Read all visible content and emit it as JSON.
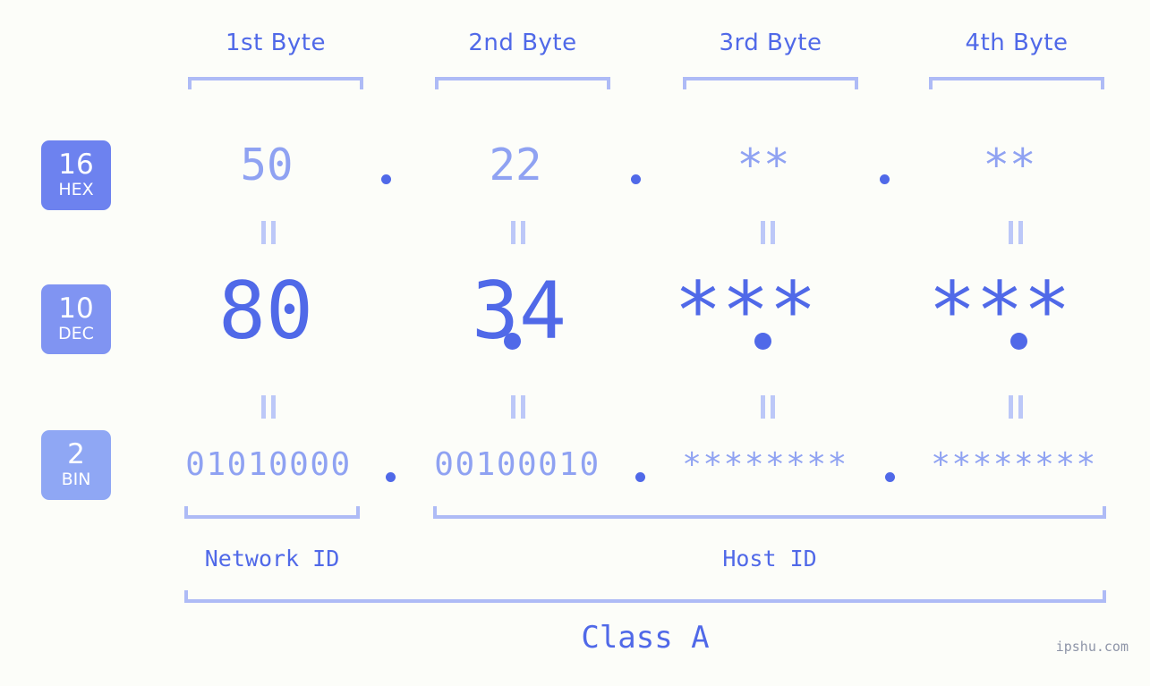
{
  "colors": {
    "background": "#fcfdf9",
    "accent_strong": "#5069e8",
    "accent_mid": "#8fa2f2",
    "accent_light": "#aebbf6",
    "connector": "#bcc8f8",
    "badge_hex": "#6d82ef",
    "badge_dec": "#8094f2",
    "badge_bin": "#8fa7f4",
    "watermark": "#8e95a8"
  },
  "byte_headers": [
    {
      "label": "1st Byte"
    },
    {
      "label": "2nd Byte"
    },
    {
      "label": "3rd Byte"
    },
    {
      "label": "4th Byte"
    }
  ],
  "badges": [
    {
      "number": "16",
      "name": "HEX"
    },
    {
      "number": "10",
      "name": "DEC"
    },
    {
      "number": "2",
      "name": "BIN"
    }
  ],
  "rows": {
    "hex": {
      "base_number": "16",
      "base_name": "HEX",
      "values": [
        "50",
        "22",
        "**",
        "**"
      ],
      "separator": "."
    },
    "dec": {
      "base_number": "10",
      "base_name": "DEC",
      "values": [
        "80",
        "34",
        "***",
        "***"
      ],
      "separator": "."
    },
    "bin": {
      "base_number": "2",
      "base_name": "BIN",
      "values": [
        "01010000",
        "00100010",
        "********",
        "********"
      ],
      "separator": "."
    }
  },
  "connectors": {
    "symbol": "=",
    "description": "equals"
  },
  "segments": {
    "network_id": "Network ID",
    "host_id": "Host ID",
    "class": "Class A"
  },
  "watermark": "ipshu.com",
  "chart_data": {
    "type": "table",
    "title": "IP address byte breakdown",
    "columns": [
      "1st Byte",
      "2nd Byte",
      "3rd Byte",
      "4th Byte"
    ],
    "rows": [
      {
        "base": "16 HEX",
        "values": [
          "50",
          "22",
          "**",
          "**"
        ]
      },
      {
        "base": "10 DEC",
        "values": [
          "80",
          "34",
          "***",
          "***"
        ]
      },
      {
        "base": "2 BIN",
        "values": [
          "01010000",
          "00100010",
          "********",
          "********"
        ]
      }
    ],
    "annotations": {
      "network_id_span": [
        "1st Byte"
      ],
      "host_id_span": [
        "2nd Byte",
        "3rd Byte",
        "4th Byte"
      ],
      "class_span": [
        "1st Byte",
        "2nd Byte",
        "3rd Byte",
        "4th Byte"
      ],
      "class": "Class A"
    }
  }
}
